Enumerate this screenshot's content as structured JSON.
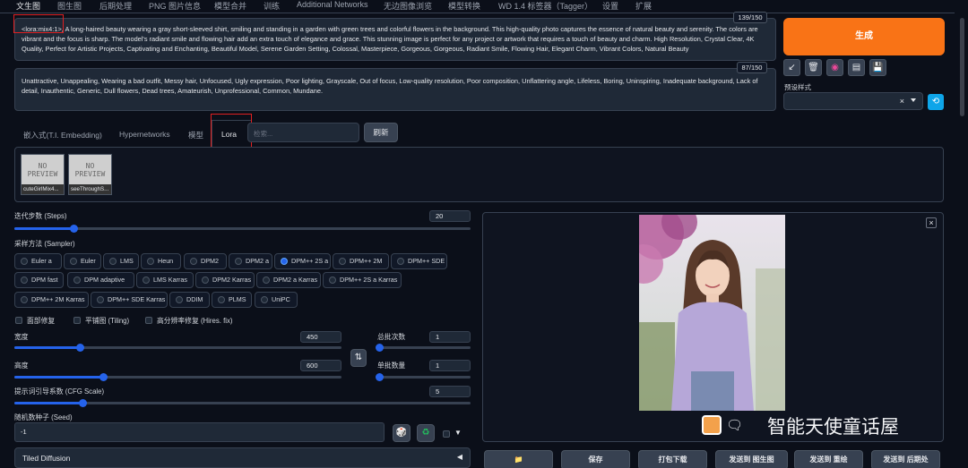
{
  "top_tabs": [
    {
      "label": "文生图",
      "active": true
    },
    {
      "label": "图生图"
    },
    {
      "label": "后期处理"
    },
    {
      "label": "PNG 图片信息"
    },
    {
      "label": "模型合并"
    },
    {
      "label": "训练"
    },
    {
      "label": "Additional Networks"
    },
    {
      "label": "无边图像浏览"
    },
    {
      "label": "模型转换"
    },
    {
      "label": "WD 1.4 标签器（Tagger）"
    },
    {
      "label": "设置"
    },
    {
      "label": "扩展"
    }
  ],
  "positive_prompt": {
    "lora_tag": "<lora:mix4:1>",
    "text": ", A long-haired beauty wearing a gray short-sleeved shirt, smiling and standing in a garden with green trees and colorful flowers in the background. This high-quality photo captures the essence of natural beauty and serenity. The colors are vibrant and the focus is sharp. The model's radiant smile and flowing hair add an extra touch of elegance and grace. This stunning image is perfect for any project or artwork that requires a touch of beauty and charm. High Resolution, Crystal Clear, 4K Quality, Perfect for Artistic Projects, Captivating and Enchanting, Beautiful Model, Serene Garden Setting, Colossal, Masterpiece, Gorgeous, Gorgeous, Radiant Smile, Flowing Hair, Elegant Charm, Vibrant Colors, Natural Beauty",
    "counter": "139/150"
  },
  "negative_prompt": {
    "text": "Unattractive, Unappealing, Wearing a bad outfit, Messy hair, Unfocused, Ugly expression, Poor lighting, Grayscale, Out of focus, Low-quality resolution, Poor composition, Unflattering angle, Lifeless, Boring, Uninspiring, Inadequate background, Lack of detail, Inauthentic, Generic, Dull flowers, Dead trees, Amateurish, Unprofessional, Common, Mundane.",
    "counter": "87/150"
  },
  "generate_label": "生成",
  "tool_icons": [
    "↙",
    "🗑",
    "◉",
    "▤",
    "💾"
  ],
  "preset_style_label": "预设样式",
  "preset_clear": "×",
  "extra_tabs": [
    "嵌入式(T.I. Embedding)",
    "Hypernetworks",
    "模型",
    "Lora"
  ],
  "search_placeholder": "检索...",
  "refresh_label": "刷新",
  "lora_cards": [
    {
      "preview": "NO\nPREVIEW",
      "name": "cuteGirlMix4..."
    },
    {
      "preview": "NO\nPREVIEW",
      "name": "seeThroughS..."
    }
  ],
  "steps": {
    "label": "迭代步数 (Steps)",
    "value": "20",
    "fraction": 0.13
  },
  "sampler": {
    "label": "采样方法 (Sampler)",
    "options": [
      "Euler a",
      "Euler",
      "LMS",
      "Heun",
      "DPM2",
      "DPM2 a",
      "DPM++ 2S a",
      "DPM++ 2M",
      "DPM++ SDE",
      "DPM fast",
      "DPM adaptive",
      "LMS Karras",
      "DPM2 Karras",
      "DPM2 a Karras",
      "DPM++ 2S a Karras",
      "DPM++ 2M Karras",
      "DPM++ SDE Karras",
      "DDIM",
      "PLMS",
      "UniPC"
    ],
    "selected": "DPM++ 2S a"
  },
  "checkboxes": [
    "面部修复",
    "平铺图 (Tiling)",
    "高分辨率修复 (Hires. fix)"
  ],
  "width": {
    "label": "宽度",
    "value": "450",
    "fraction": 0.2
  },
  "height": {
    "label": "高度",
    "value": "600",
    "fraction": 0.27
  },
  "batch_count": {
    "label": "总批次数",
    "value": "1",
    "fraction": 0.0
  },
  "batch_size": {
    "label": "单批数量",
    "value": "1",
    "fraction": 0.0
  },
  "swap_icon": "⇅",
  "cfg": {
    "label": "提示词引导系数 (CFG Scale)",
    "value": "5",
    "fraction": 0.15
  },
  "seed": {
    "label": "随机数种子 (Seed)",
    "value": "-1"
  },
  "tiled_diffusion": "Tiled Diffusion",
  "image_close": "×",
  "watermark": "智能天使童话屋",
  "bottom_buttons": [
    "📁",
    "保存",
    "打包下载",
    "发送到 图生图",
    "发送到 重绘",
    "发送到 后期处"
  ]
}
